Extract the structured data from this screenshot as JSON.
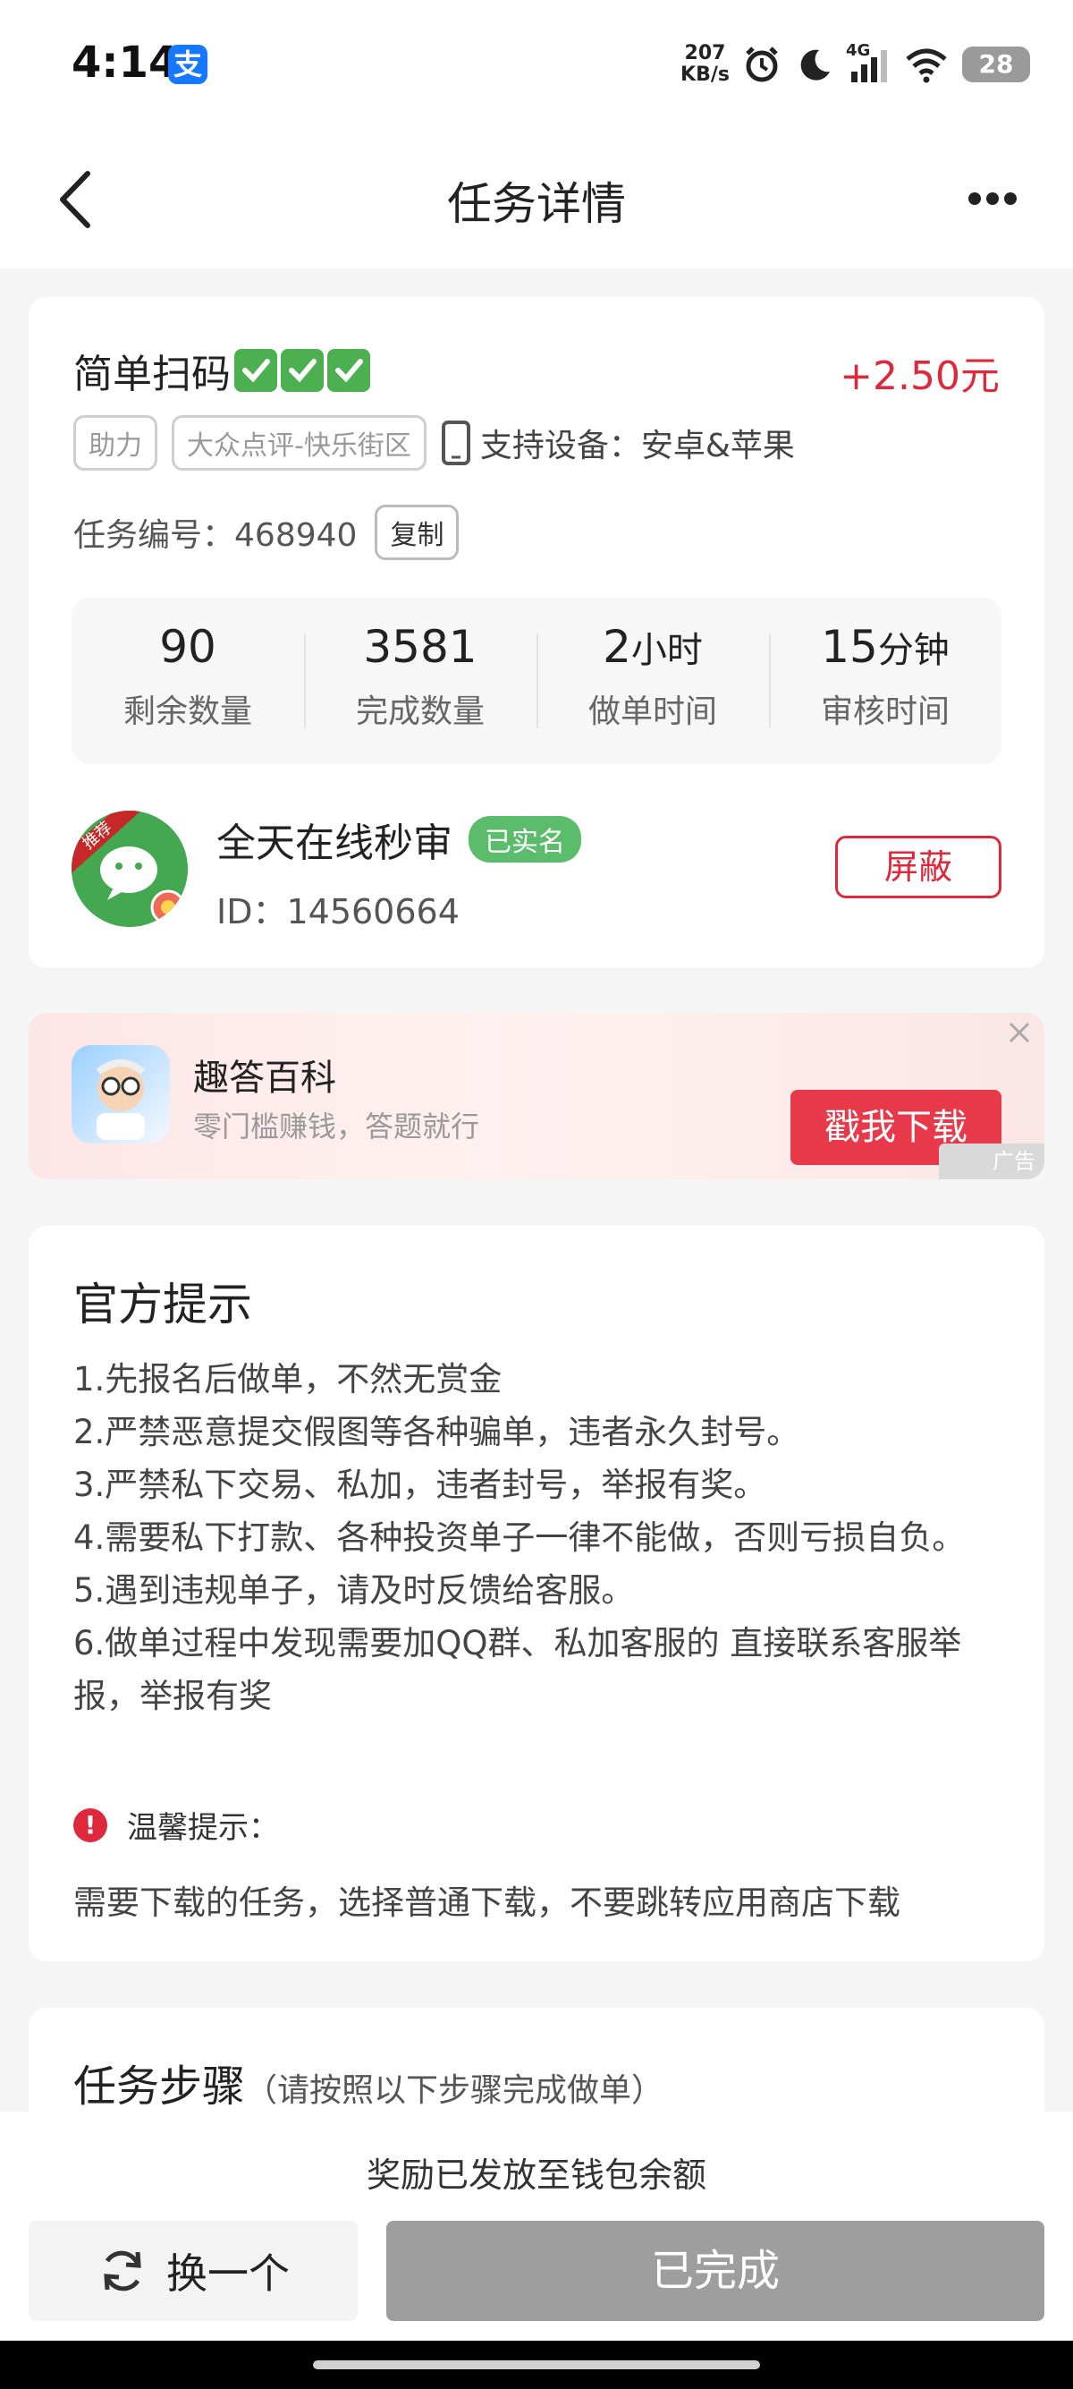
{
  "status": {
    "time": "4:14",
    "app_badge": "支",
    "speed_value": "207",
    "speed_unit": "KB/s",
    "network": "4G",
    "battery": "28"
  },
  "nav": {
    "title": "任务详情"
  },
  "task": {
    "title": "简单扫码",
    "reward": "+2.50元",
    "tags": [
      "助力",
      "大众点评-快乐街区"
    ],
    "device_label": "支持设备：安卓&苹果",
    "number_label": "任务编号：",
    "number": "468940",
    "copy_label": "复制",
    "stats": [
      {
        "value": "90",
        "unit": "",
        "label": "剩余数量"
      },
      {
        "value": "3581",
        "unit": "",
        "label": "完成数量"
      },
      {
        "value": "2",
        "unit": "小时",
        "label": "做单时间"
      },
      {
        "value": "15",
        "unit": "分钟",
        "label": "审核时间"
      }
    ]
  },
  "publisher": {
    "badge": "推荐",
    "name": "全天在线秒审",
    "verified": "已实名",
    "id_label": "ID：14560664",
    "block_label": "屏蔽"
  },
  "ad": {
    "name": "趣答百科",
    "desc": "零门槛赚钱，答题就行",
    "button": "戳我下载",
    "badge": "广告"
  },
  "tips": {
    "title": "官方提示",
    "items": [
      "1.先报名后做单，不然无赏金",
      "2.严禁恶意提交假图等各种骗单，违者永久封号。",
      "3.严禁私下交易、私加，违者封号，举报有奖。",
      "4.需要私下打款、各种投资单子一律不能做，否则亏损自负。",
      "5.遇到违规单子，请及时反馈给客服。",
      "6.做单过程中发现需要加QQ群、私加客服的 直接联系客服举报，举报有奖"
    ],
    "warm_label": "温馨提示：",
    "warm_text": "需要下载的任务，选择普通下载，不要跳转应用商店下载"
  },
  "steps": {
    "title": "任务步骤",
    "subtitle": "（请按照以下步骤完成做单）"
  },
  "bottom": {
    "note": "奖励已发放至钱包余额",
    "swap_label": "换一个",
    "done_label": "已完成"
  },
  "colors": {
    "accent_red": "#e0283c",
    "verified_green": "#5bbd6c",
    "done_gray": "#9e9e9e"
  }
}
